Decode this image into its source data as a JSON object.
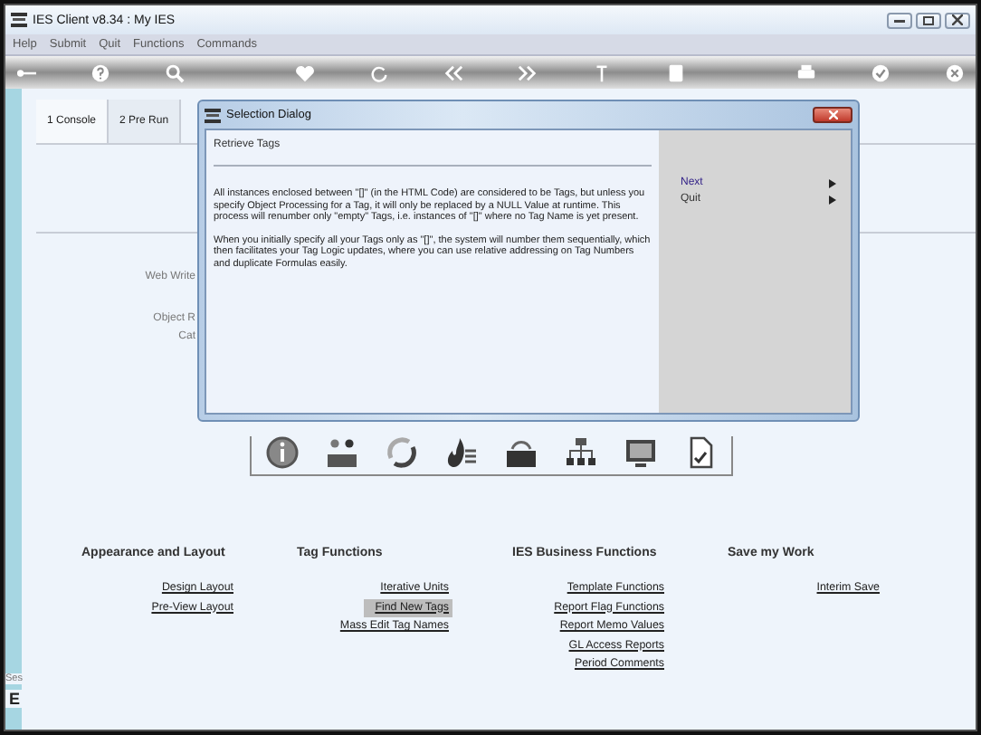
{
  "window": {
    "title": "IES Client v8.34 : My IES"
  },
  "menu": [
    "Help",
    "Submit",
    "Quit",
    "Functions",
    "Commands"
  ],
  "tabs": [
    {
      "label": "1 Console",
      "selected": true
    },
    {
      "label": "2 Pre Run",
      "selected": false
    }
  ],
  "background_labels": [
    "Web Write",
    "Object R",
    "Cat"
  ],
  "dialog": {
    "title": "Selection Dialog",
    "heading": "Retrieve Tags",
    "paragraphs": [
      "All instances enclosed between \"[]\" (in the HTML Code) are considered to be Tags, but unless you specify Object Processing for a Tag, it will only be replaced by a NULL Value at runtime. This process will renumber only \"empty\" Tags, i.e. instances of \"[]\" where no Tag Name is yet present.",
      "When you initially specify all your Tags only as \"[]\", the system will number them sequentially, which then facilitates your Tag Logic updates, where you can use relative addressing on Tag Numbers and duplicate Formulas easily."
    ],
    "actions": [
      {
        "label": "Next",
        "selected": true
      },
      {
        "label": "Quit",
        "selected": false
      }
    ]
  },
  "sections": [
    {
      "title": "Appearance and Layout",
      "links": [
        {
          "label": "Design Layout",
          "selected": false
        },
        {
          "label": "Pre-View Layout",
          "selected": false
        }
      ]
    },
    {
      "title": "Tag Functions",
      "links": [
        {
          "label": "Iterative Units",
          "selected": false
        },
        {
          "label": "Find New Tags",
          "selected": true
        },
        {
          "label": "Mass Edit Tag Names",
          "selected": false
        }
      ]
    },
    {
      "title": "IES Business Functions",
      "links": [
        {
          "label": "Template Functions",
          "selected": false
        },
        {
          "label": "Report Flag Functions",
          "selected": false
        },
        {
          "label": "Report Memo Values",
          "selected": false
        },
        {
          "label": "GL Access Reports",
          "selected": false
        },
        {
          "label": "Period Comments",
          "selected": false
        }
      ]
    },
    {
      "title": "Save my Work",
      "links": [
        {
          "label": "Interim Save",
          "selected": false
        }
      ]
    }
  ],
  "status_fragments": [
    "Ses",
    "E"
  ]
}
